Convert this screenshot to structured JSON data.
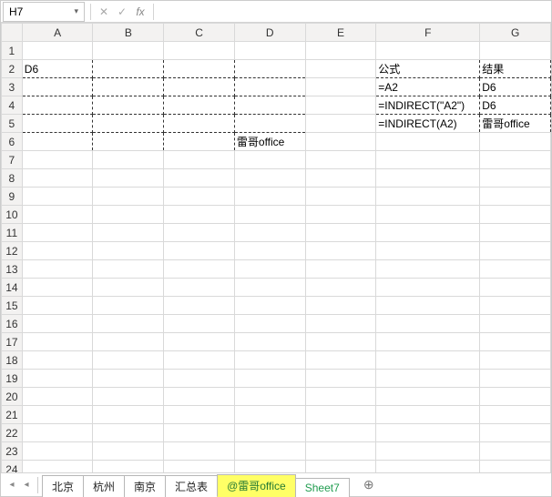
{
  "formula_bar": {
    "name_box": "H7",
    "cancel": "✕",
    "confirm": "✓",
    "fx": "fx",
    "input": ""
  },
  "columns": [
    "A",
    "B",
    "C",
    "D",
    "E",
    "F",
    "G"
  ],
  "rows_visible": 24,
  "cells": {
    "A2": "D6",
    "D6": "雷哥office",
    "F2": "公式",
    "G2": "结果",
    "F3": "=A2",
    "G3": "D6",
    "F4": "=INDIRECT(\"A2\")",
    "G4": "D6",
    "F5": "=INDIRECT(A2)",
    "G5": "雷哥office"
  },
  "dashed_range_1": [
    "A2",
    "D6"
  ],
  "dashed_range_2": [
    "F2",
    "G5"
  ],
  "sheet_tabs": {
    "nav_first": "◂",
    "nav_prev": "◂",
    "items": [
      {
        "label": "北京",
        "active": false
      },
      {
        "label": "杭州",
        "active": false
      },
      {
        "label": "南京",
        "active": false
      },
      {
        "label": "汇总表",
        "active": false
      },
      {
        "label": "@雷哥office",
        "active": true
      },
      {
        "label": "Sheet7",
        "active": false,
        "class": "sheet7"
      }
    ],
    "add": "⊕"
  }
}
